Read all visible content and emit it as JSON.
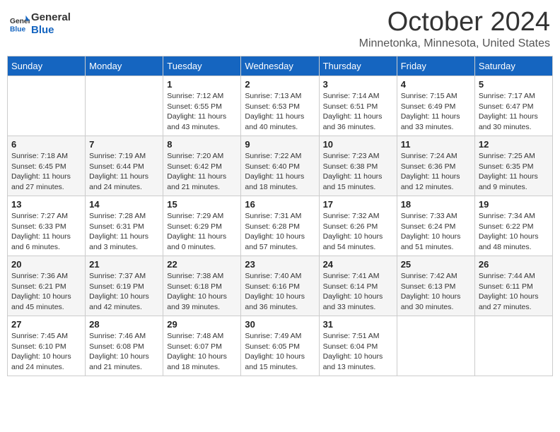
{
  "header": {
    "logo_line1": "General",
    "logo_line2": "Blue",
    "month": "October 2024",
    "location": "Minnetonka, Minnesota, United States"
  },
  "days_of_week": [
    "Sunday",
    "Monday",
    "Tuesday",
    "Wednesday",
    "Thursday",
    "Friday",
    "Saturday"
  ],
  "weeks": [
    [
      {
        "day": "",
        "sunrise": "",
        "sunset": "",
        "daylight": ""
      },
      {
        "day": "",
        "sunrise": "",
        "sunset": "",
        "daylight": ""
      },
      {
        "day": "1",
        "sunrise": "Sunrise: 7:12 AM",
        "sunset": "Sunset: 6:55 PM",
        "daylight": "Daylight: 11 hours and 43 minutes."
      },
      {
        "day": "2",
        "sunrise": "Sunrise: 7:13 AM",
        "sunset": "Sunset: 6:53 PM",
        "daylight": "Daylight: 11 hours and 40 minutes."
      },
      {
        "day": "3",
        "sunrise": "Sunrise: 7:14 AM",
        "sunset": "Sunset: 6:51 PM",
        "daylight": "Daylight: 11 hours and 36 minutes."
      },
      {
        "day": "4",
        "sunrise": "Sunrise: 7:15 AM",
        "sunset": "Sunset: 6:49 PM",
        "daylight": "Daylight: 11 hours and 33 minutes."
      },
      {
        "day": "5",
        "sunrise": "Sunrise: 7:17 AM",
        "sunset": "Sunset: 6:47 PM",
        "daylight": "Daylight: 11 hours and 30 minutes."
      }
    ],
    [
      {
        "day": "6",
        "sunrise": "Sunrise: 7:18 AM",
        "sunset": "Sunset: 6:45 PM",
        "daylight": "Daylight: 11 hours and 27 minutes."
      },
      {
        "day": "7",
        "sunrise": "Sunrise: 7:19 AM",
        "sunset": "Sunset: 6:44 PM",
        "daylight": "Daylight: 11 hours and 24 minutes."
      },
      {
        "day": "8",
        "sunrise": "Sunrise: 7:20 AM",
        "sunset": "Sunset: 6:42 PM",
        "daylight": "Daylight: 11 hours and 21 minutes."
      },
      {
        "day": "9",
        "sunrise": "Sunrise: 7:22 AM",
        "sunset": "Sunset: 6:40 PM",
        "daylight": "Daylight: 11 hours and 18 minutes."
      },
      {
        "day": "10",
        "sunrise": "Sunrise: 7:23 AM",
        "sunset": "Sunset: 6:38 PM",
        "daylight": "Daylight: 11 hours and 15 minutes."
      },
      {
        "day": "11",
        "sunrise": "Sunrise: 7:24 AM",
        "sunset": "Sunset: 6:36 PM",
        "daylight": "Daylight: 11 hours and 12 minutes."
      },
      {
        "day": "12",
        "sunrise": "Sunrise: 7:25 AM",
        "sunset": "Sunset: 6:35 PM",
        "daylight": "Daylight: 11 hours and 9 minutes."
      }
    ],
    [
      {
        "day": "13",
        "sunrise": "Sunrise: 7:27 AM",
        "sunset": "Sunset: 6:33 PM",
        "daylight": "Daylight: 11 hours and 6 minutes."
      },
      {
        "day": "14",
        "sunrise": "Sunrise: 7:28 AM",
        "sunset": "Sunset: 6:31 PM",
        "daylight": "Daylight: 11 hours and 3 minutes."
      },
      {
        "day": "15",
        "sunrise": "Sunrise: 7:29 AM",
        "sunset": "Sunset: 6:29 PM",
        "daylight": "Daylight: 11 hours and 0 minutes."
      },
      {
        "day": "16",
        "sunrise": "Sunrise: 7:31 AM",
        "sunset": "Sunset: 6:28 PM",
        "daylight": "Daylight: 10 hours and 57 minutes."
      },
      {
        "day": "17",
        "sunrise": "Sunrise: 7:32 AM",
        "sunset": "Sunset: 6:26 PM",
        "daylight": "Daylight: 10 hours and 54 minutes."
      },
      {
        "day": "18",
        "sunrise": "Sunrise: 7:33 AM",
        "sunset": "Sunset: 6:24 PM",
        "daylight": "Daylight: 10 hours and 51 minutes."
      },
      {
        "day": "19",
        "sunrise": "Sunrise: 7:34 AM",
        "sunset": "Sunset: 6:22 PM",
        "daylight": "Daylight: 10 hours and 48 minutes."
      }
    ],
    [
      {
        "day": "20",
        "sunrise": "Sunrise: 7:36 AM",
        "sunset": "Sunset: 6:21 PM",
        "daylight": "Daylight: 10 hours and 45 minutes."
      },
      {
        "day": "21",
        "sunrise": "Sunrise: 7:37 AM",
        "sunset": "Sunset: 6:19 PM",
        "daylight": "Daylight: 10 hours and 42 minutes."
      },
      {
        "day": "22",
        "sunrise": "Sunrise: 7:38 AM",
        "sunset": "Sunset: 6:18 PM",
        "daylight": "Daylight: 10 hours and 39 minutes."
      },
      {
        "day": "23",
        "sunrise": "Sunrise: 7:40 AM",
        "sunset": "Sunset: 6:16 PM",
        "daylight": "Daylight: 10 hours and 36 minutes."
      },
      {
        "day": "24",
        "sunrise": "Sunrise: 7:41 AM",
        "sunset": "Sunset: 6:14 PM",
        "daylight": "Daylight: 10 hours and 33 minutes."
      },
      {
        "day": "25",
        "sunrise": "Sunrise: 7:42 AM",
        "sunset": "Sunset: 6:13 PM",
        "daylight": "Daylight: 10 hours and 30 minutes."
      },
      {
        "day": "26",
        "sunrise": "Sunrise: 7:44 AM",
        "sunset": "Sunset: 6:11 PM",
        "daylight": "Daylight: 10 hours and 27 minutes."
      }
    ],
    [
      {
        "day": "27",
        "sunrise": "Sunrise: 7:45 AM",
        "sunset": "Sunset: 6:10 PM",
        "daylight": "Daylight: 10 hours and 24 minutes."
      },
      {
        "day": "28",
        "sunrise": "Sunrise: 7:46 AM",
        "sunset": "Sunset: 6:08 PM",
        "daylight": "Daylight: 10 hours and 21 minutes."
      },
      {
        "day": "29",
        "sunrise": "Sunrise: 7:48 AM",
        "sunset": "Sunset: 6:07 PM",
        "daylight": "Daylight: 10 hours and 18 minutes."
      },
      {
        "day": "30",
        "sunrise": "Sunrise: 7:49 AM",
        "sunset": "Sunset: 6:05 PM",
        "daylight": "Daylight: 10 hours and 15 minutes."
      },
      {
        "day": "31",
        "sunrise": "Sunrise: 7:51 AM",
        "sunset": "Sunset: 6:04 PM",
        "daylight": "Daylight: 10 hours and 13 minutes."
      },
      {
        "day": "",
        "sunrise": "",
        "sunset": "",
        "daylight": ""
      },
      {
        "day": "",
        "sunrise": "",
        "sunset": "",
        "daylight": ""
      }
    ]
  ]
}
